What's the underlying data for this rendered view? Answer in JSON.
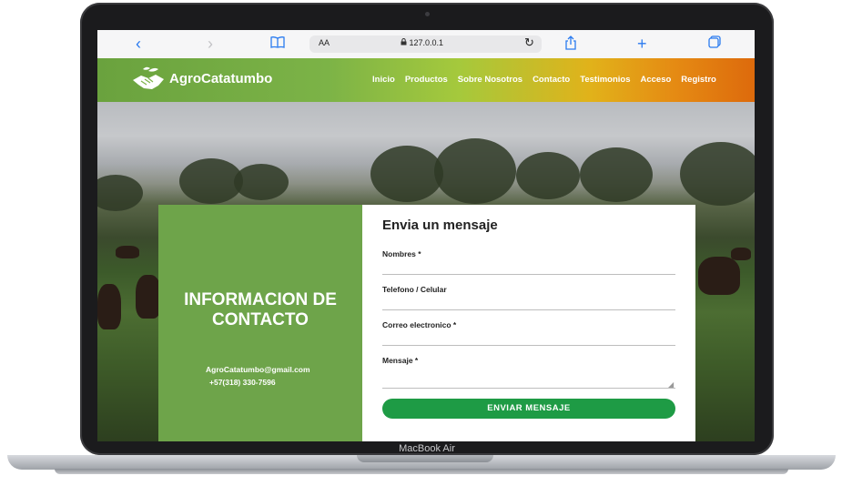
{
  "device": {
    "label": "MacBook Air"
  },
  "browser": {
    "text_size": "AA",
    "url": "127.0.0.1",
    "icons": [
      "back-icon",
      "forward-icon",
      "bookmarks-icon",
      "reload-icon",
      "share-icon",
      "new-tab-icon",
      "tabs-icon"
    ]
  },
  "site": {
    "logo_text": "AgroCatatumbo",
    "nav": [
      "Inicio",
      "Productos",
      "Sobre Nosotros",
      "Contacto",
      "Testimonios",
      "Acceso",
      "Registro"
    ]
  },
  "contact": {
    "title": "INFORMACION DE CONTACTO",
    "email": "AgroCatatumbo@gmail.com",
    "phone": "+57(318) 330-7596"
  },
  "form": {
    "title": "Envia un mensaje",
    "fields": [
      "Nombres *",
      "Telefono / Celular",
      "Correo electronico *",
      "Mensaje *"
    ],
    "submit": "ENVIAR MENSAJE"
  },
  "colors": {
    "nav_green": "#7cb347",
    "nav_orange": "#dd6a0c",
    "card_green": "#6ea44a",
    "button_green": "#1e9b45"
  }
}
